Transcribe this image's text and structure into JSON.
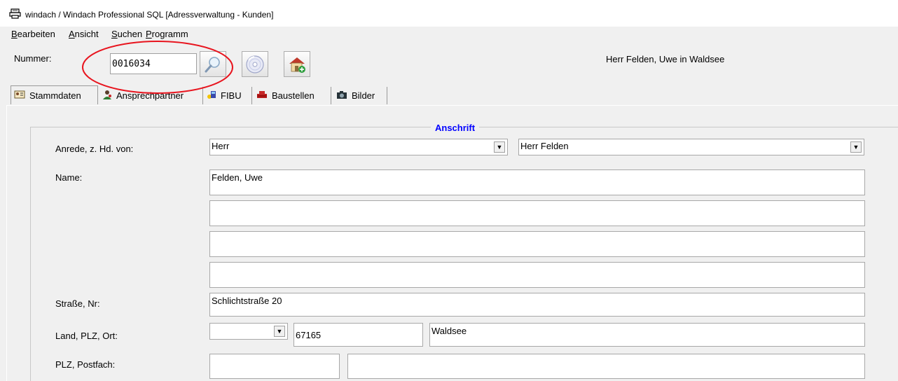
{
  "window": {
    "title": "windach / Windach Professional SQL [Adressverwaltung - Kunden]"
  },
  "menu": {
    "items": [
      {
        "underline": "B",
        "rest": "earbeiten"
      },
      {
        "underline": "A",
        "rest": "nsicht"
      },
      {
        "underline": "S",
        "rest": "uchen"
      },
      {
        "underline": "P",
        "rest": "rogramm"
      }
    ]
  },
  "toolbar": {
    "nummer_label": "Nummer:",
    "nummer_value": "0016034",
    "header_info": "Herr Felden, Uwe in Waldsee"
  },
  "tabs": [
    {
      "label": "Stammdaten",
      "icon": "address-card-icon",
      "active": true
    },
    {
      "label": "Ansprechpartner",
      "icon": "person-icon",
      "active": false
    },
    {
      "label": "FIBU",
      "icon": "accounting-icon",
      "active": false
    },
    {
      "label": "Baustellen",
      "icon": "construction-icon",
      "active": false
    },
    {
      "label": "Bilder",
      "icon": "camera-icon",
      "active": false
    }
  ],
  "form": {
    "group_title": "Anschrift",
    "anrede_label": "Anrede, z. Hd. von:",
    "anrede_value": "Herr",
    "zhd_value": "Herr Felden",
    "name_label": "Name:",
    "name1": "Felden, Uwe",
    "name2": "",
    "name3": "",
    "name4": "",
    "strasse_label": "Straße, Nr:",
    "strasse_value": "Schlichtstraße 20",
    "land_label": "Land, PLZ, Ort:",
    "land_value": "",
    "plz_value": "67165",
    "ort_value": "Waldsee",
    "postfach_label": "PLZ, Postfach:",
    "postfach_plz": "",
    "postfach_value": ""
  },
  "colors": {
    "group_title": "#0000ff",
    "annotation": "#e8141e"
  }
}
